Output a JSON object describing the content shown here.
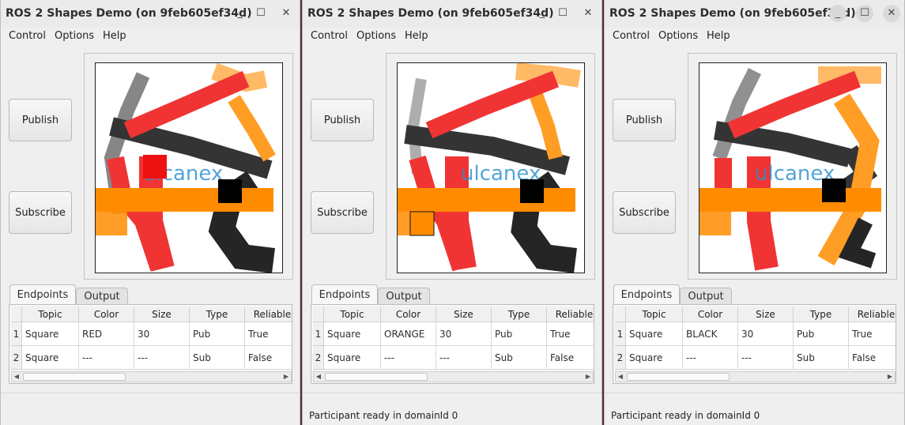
{
  "windows": [
    {
      "title": "ROS 2 Shapes Demo (on 9feb605ef34d)",
      "minimize": "_",
      "maximize": "☐",
      "close": "✕",
      "menus": [
        "Control",
        "Options",
        "Help"
      ],
      "publish_label": "Publish",
      "subscribe_label": "Subscribe",
      "tabs": [
        "Endpoints",
        "Output"
      ],
      "columns": [
        "Topic",
        "Color",
        "Size",
        "Type",
        "Reliable"
      ],
      "rows": [
        {
          "num": "1",
          "topic": "Square",
          "color": "RED",
          "size": "30",
          "type": "Pub",
          "reliable": "True"
        },
        {
          "num": "2",
          "topic": "Square",
          "color": "---",
          "size": "---",
          "type": "Sub",
          "reliable": "False"
        }
      ],
      "status": ""
    },
    {
      "title": "ROS 2 Shapes Demo (on 9feb605ef34d)",
      "minimize": "_",
      "maximize": "☐",
      "close": "✕",
      "menus": [
        "Control",
        "Options",
        "Help"
      ],
      "publish_label": "Publish",
      "subscribe_label": "Subscribe",
      "tabs": [
        "Endpoints",
        "Output"
      ],
      "columns": [
        "Topic",
        "Color",
        "Size",
        "Type",
        "Reliable"
      ],
      "rows": [
        {
          "num": "1",
          "topic": "Square",
          "color": "ORANGE",
          "size": "30",
          "type": "Pub",
          "reliable": "True"
        },
        {
          "num": "2",
          "topic": "Square",
          "color": "---",
          "size": "---",
          "type": "Sub",
          "reliable": "False"
        }
      ],
      "status": "Participant ready in domainId 0"
    },
    {
      "title": "ROS 2 Shapes Demo (on 9feb605ef34d)",
      "minimize": "_",
      "maximize": "☐",
      "close": "✕",
      "menus": [
        "Control",
        "Options",
        "Help"
      ],
      "publish_label": "Publish",
      "subscribe_label": "Subscribe",
      "tabs": [
        "Endpoints",
        "Output"
      ],
      "columns": [
        "Topic",
        "Color",
        "Size",
        "Type",
        "Reliable"
      ],
      "rows": [
        {
          "num": "1",
          "topic": "Square",
          "color": "BLACK",
          "size": "30",
          "type": "Pub",
          "reliable": "True"
        },
        {
          "num": "2",
          "topic": "Square",
          "color": "---",
          "size": "---",
          "type": "Sub",
          "reliable": "False"
        }
      ],
      "status": "Participant ready in domainId 0"
    }
  ],
  "canvas_logo_text": "ulcanex",
  "colors": {
    "red": "#ee1111",
    "orange": "#ff8c00",
    "black": "#000000",
    "logo": "#2a8fd0"
  }
}
